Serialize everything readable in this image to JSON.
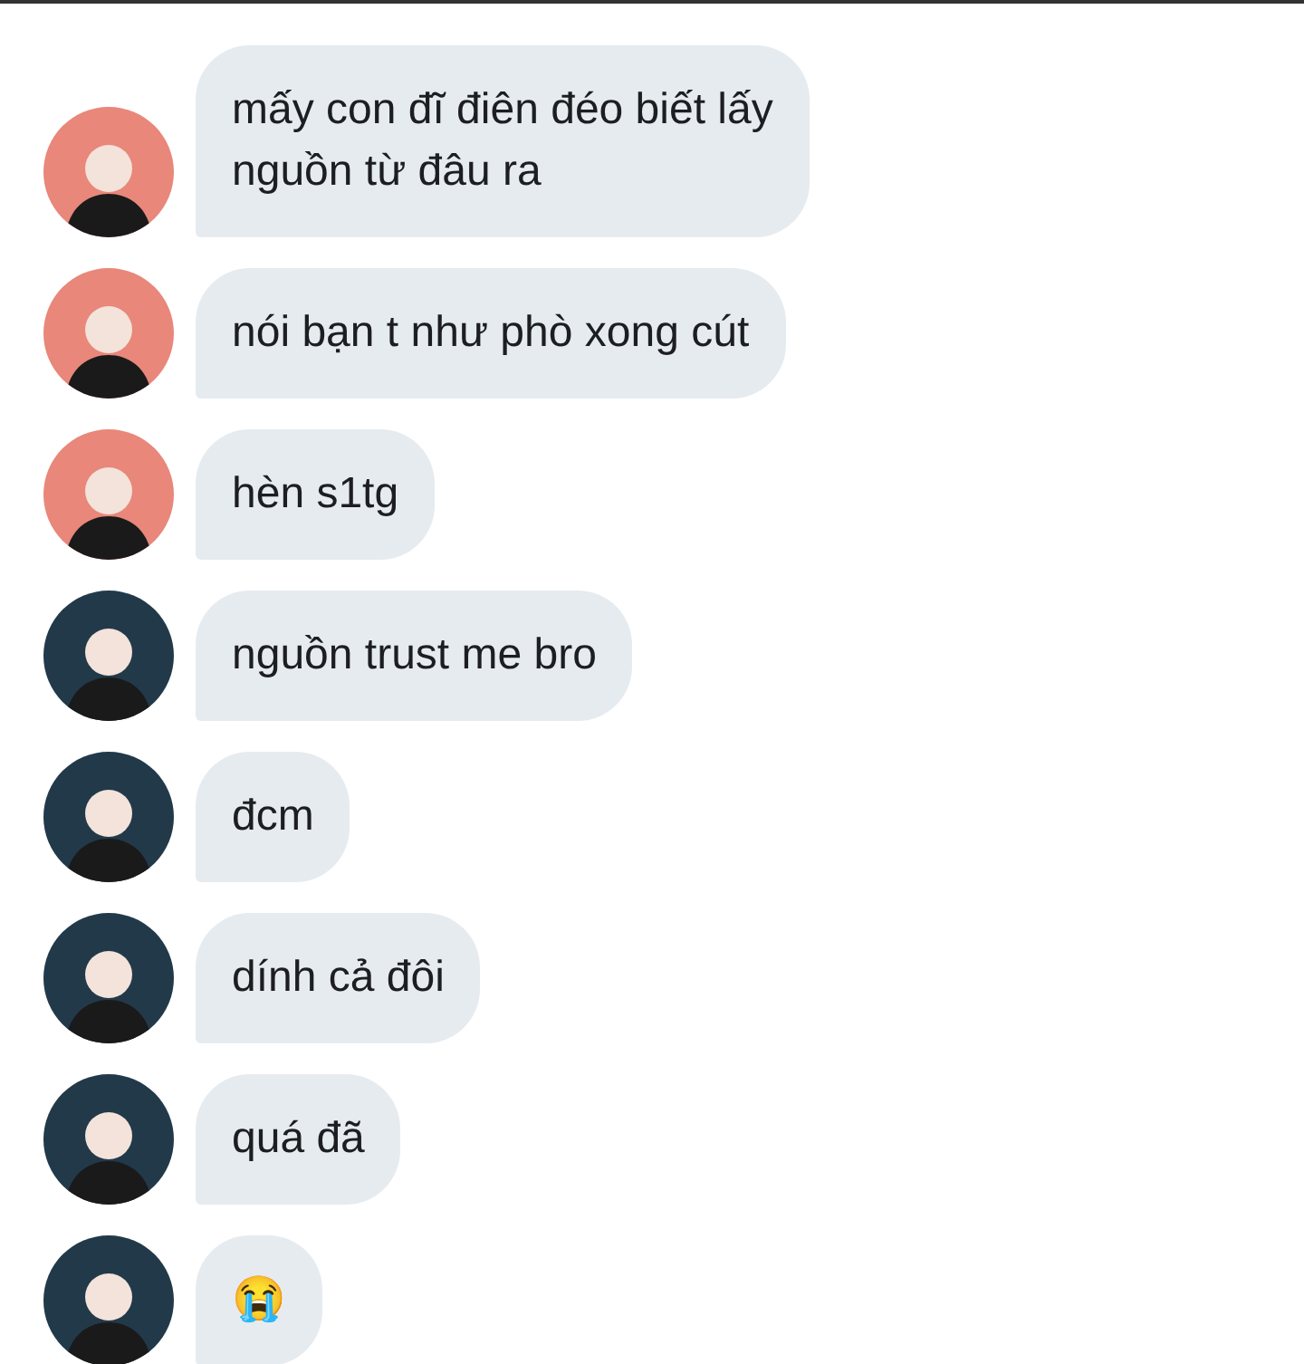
{
  "messages": [
    {
      "text": "mấy con đĩ điên đéo biết lấy\nnguồn từ đâu ra",
      "color": "#e8877a"
    },
    {
      "text": "nói bạn t như phò xong cút",
      "color": "#e8877a"
    },
    {
      "text": "hèn s1tg",
      "color": "#e8877a"
    },
    {
      "text": "nguồn trust me bro",
      "color": "#22394a"
    },
    {
      "text": "đcm",
      "color": "#22394a"
    },
    {
      "text": "dính cả đôi",
      "color": "#22394a"
    },
    {
      "text": "quá đã",
      "color": "#22394a"
    },
    {
      "text": "😭",
      "color": "#22394a"
    }
  ]
}
